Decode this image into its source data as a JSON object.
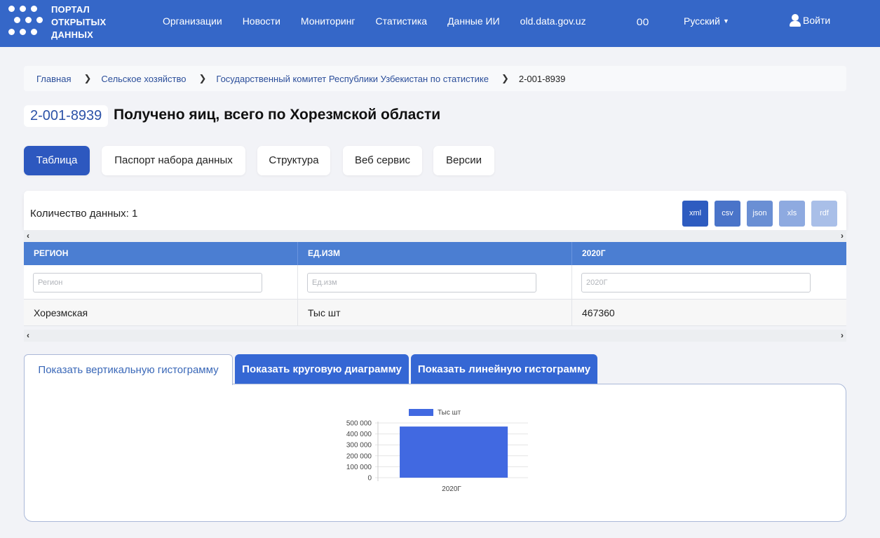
{
  "header": {
    "logo_lines": [
      "ПОРТАЛ",
      "ОТКРЫТЫХ",
      "ДАННЫХ"
    ],
    "nav": [
      "Организации",
      "Новости",
      "Мониторинг",
      "Статистика",
      "Данные ИИ",
      "old.data.gov.uz"
    ],
    "accessibility_glyph": "൦൦",
    "language": "Русский",
    "login": "Войти"
  },
  "breadcrumb": {
    "items": [
      "Главная",
      "Сельское хозяйство",
      "Государственный комитет Республики Узбекистан по статистике"
    ],
    "current": "2-001-8939",
    "separator": "❯"
  },
  "title": {
    "code": "2-001-8939",
    "text": "Получено яиц, всего по Хорезмской области"
  },
  "tabs": [
    "Таблица",
    "Паспорт набора данных",
    "Структура",
    "Веб сервис",
    "Версии"
  ],
  "data_card": {
    "count_label": "Количество данных: 1",
    "formats": [
      {
        "label": "xml",
        "color": "#2e5cc0"
      },
      {
        "label": "csv",
        "color": "#4a74c9"
      },
      {
        "label": "json",
        "color": "#6a8fd4"
      },
      {
        "label": "xls",
        "color": "#8eaae0"
      },
      {
        "label": "rdf",
        "color": "#a9bfe8"
      }
    ]
  },
  "scroll": {
    "left": "‹",
    "right": "›"
  },
  "table": {
    "headers": [
      "РЕГИОН",
      "ЕД.ИЗМ",
      "2020Г"
    ],
    "filters": [
      "Регион",
      "Ед.изм",
      "2020Г"
    ],
    "rows": [
      [
        "Хорезмская",
        "Тыс шт",
        "467360"
      ]
    ]
  },
  "chart_tabs": [
    "Показать вертикальную гистограмму",
    "Показать круговую диаграмму",
    "Показать линейную гистограмму"
  ],
  "chart_data": {
    "type": "bar",
    "categories": [
      "2020Г"
    ],
    "series": [
      {
        "name": "Тыс шт",
        "values": [
          467360
        ],
        "color": "#4169e1"
      }
    ],
    "yticks": [
      "0",
      "100 000",
      "200 000",
      "300 000",
      "400 000",
      "500 000"
    ],
    "ylim": [
      0,
      500000
    ],
    "legend": "top",
    "grid": true
  }
}
